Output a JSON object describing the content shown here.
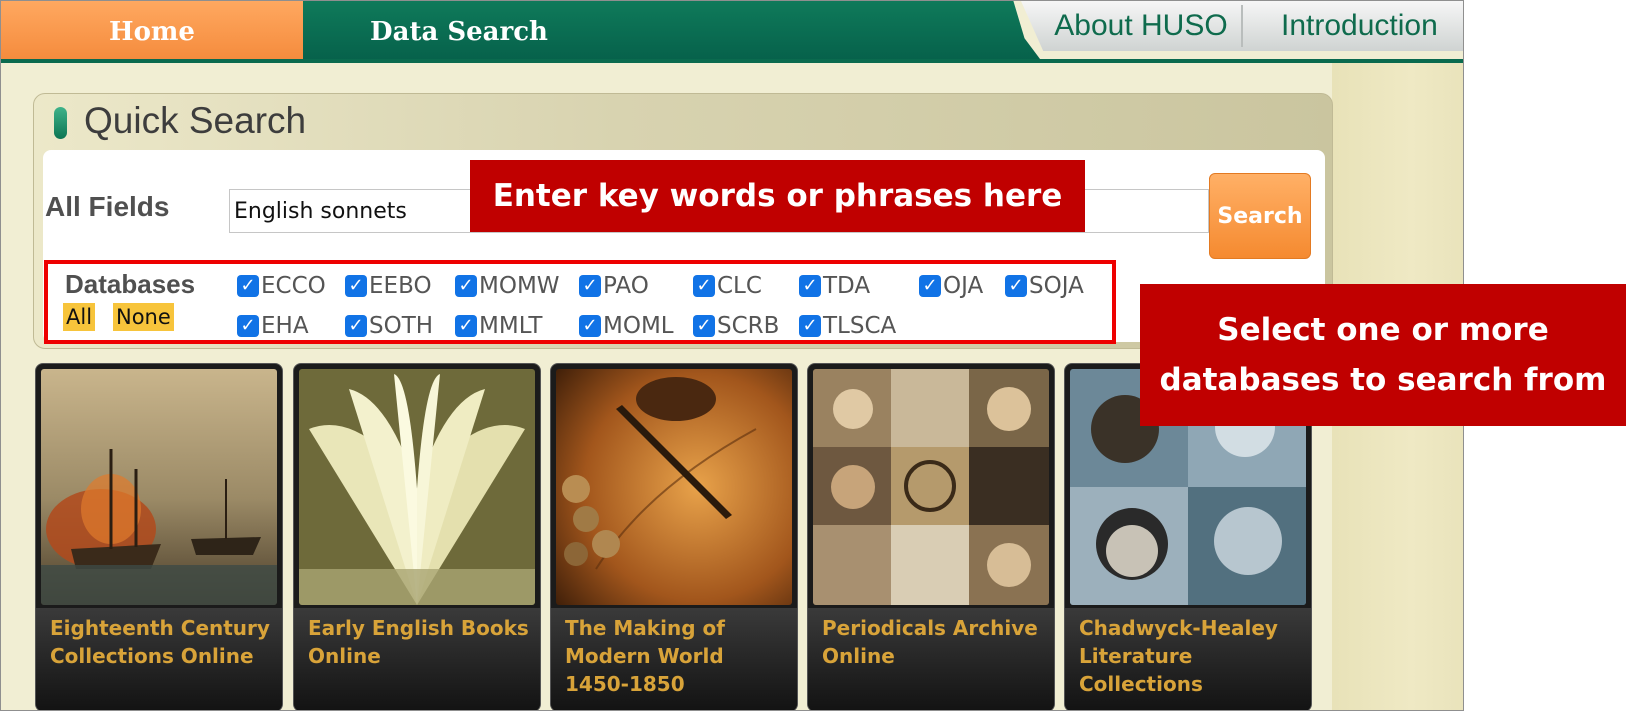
{
  "nav": {
    "home": "Home",
    "data_search": "Data Search",
    "about": "About HUSO",
    "introduction": "Introduction"
  },
  "quick_search": {
    "title": "Quick Search",
    "all_fields_label": "All Fields",
    "query_value": "English sonnets",
    "search_button": "Search",
    "databases_label": "Databases",
    "select_all": "All",
    "select_none": "None",
    "databases": [
      {
        "label": "ECCO",
        "checked": true
      },
      {
        "label": "EEBO",
        "checked": true
      },
      {
        "label": "MOMW",
        "checked": true
      },
      {
        "label": "PAO",
        "checked": true
      },
      {
        "label": "CLC",
        "checked": true
      },
      {
        "label": "TDA",
        "checked": true
      },
      {
        "label": "OJA",
        "checked": true
      },
      {
        "label": "SOJA",
        "checked": true
      },
      {
        "label": "EHA",
        "checked": true
      },
      {
        "label": "SOTH",
        "checked": true
      },
      {
        "label": "MMLT",
        "checked": true
      },
      {
        "label": "MOML",
        "checked": true
      },
      {
        "label": "SCRB",
        "checked": true
      },
      {
        "label": "TLSCA",
        "checked": true
      }
    ],
    "checkbox_color": "#1173e6"
  },
  "collections": [
    {
      "title": "Eighteenth Century Collections Online",
      "icon": "sailing-ships-painting"
    },
    {
      "title": "Early English Books Online",
      "icon": "open-book-photo"
    },
    {
      "title": "The Making of Modern World 1450-1850",
      "icon": "quill-map-coins-photo"
    },
    {
      "title": "Periodicals Archive Online",
      "icon": "portrait-collage"
    },
    {
      "title": "Chadwyck-Healey Literature Collections",
      "icon": "author-portraits-collage"
    }
  ],
  "annotations": {
    "enter_keywords": "Enter key words or phrases here",
    "select_databases": "Select one or more databases to search from",
    "color": "#c00000"
  },
  "colors": {
    "home_tab": "#f48a3b",
    "nav_green": "#06604a",
    "card_title": "#d8a339",
    "page_bg": "#f1eed3"
  }
}
